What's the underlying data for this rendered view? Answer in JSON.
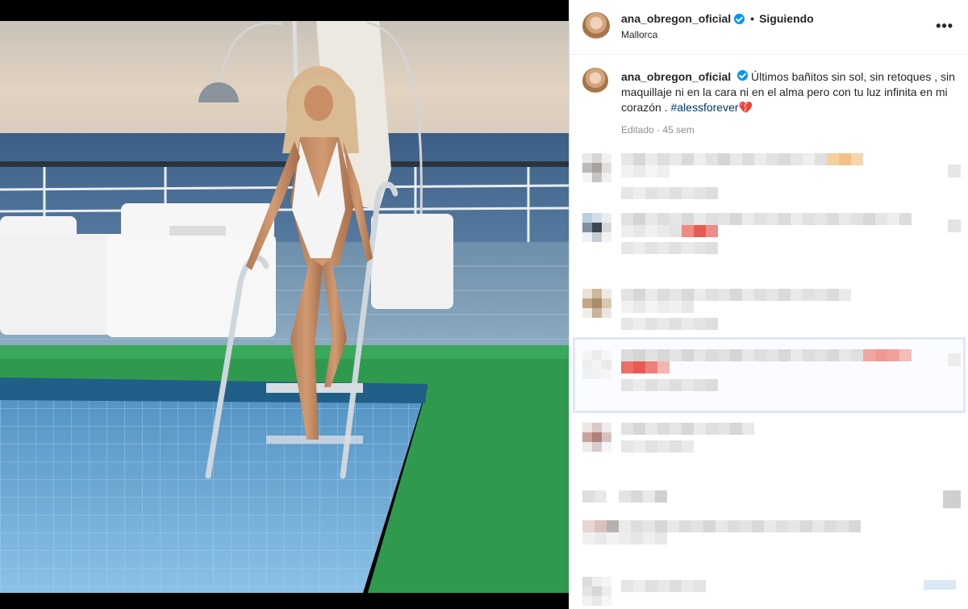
{
  "post": {
    "username": "ana_obregon_oficial",
    "dot": "•",
    "follow_label": "Siguiendo",
    "location": "Mallorca",
    "more_icon": "more-horizontal-icon",
    "more_glyph": "•••"
  },
  "caption": {
    "username": "ana_obregon_oficial",
    "text": "Últimos bañitos sin sol, sin retoques , sin maquillaje ni en la cara ni en el alma pero con tu luz infinita en mi corazón . ",
    "hashtag": "#alessforever",
    "emoji": "💔",
    "meta": "Editado · 45 sem"
  },
  "colors": {
    "verified": "#0095f6",
    "hashtag": "#00376b",
    "muted": "#8e8e8e",
    "border": "#dbdbdb"
  }
}
